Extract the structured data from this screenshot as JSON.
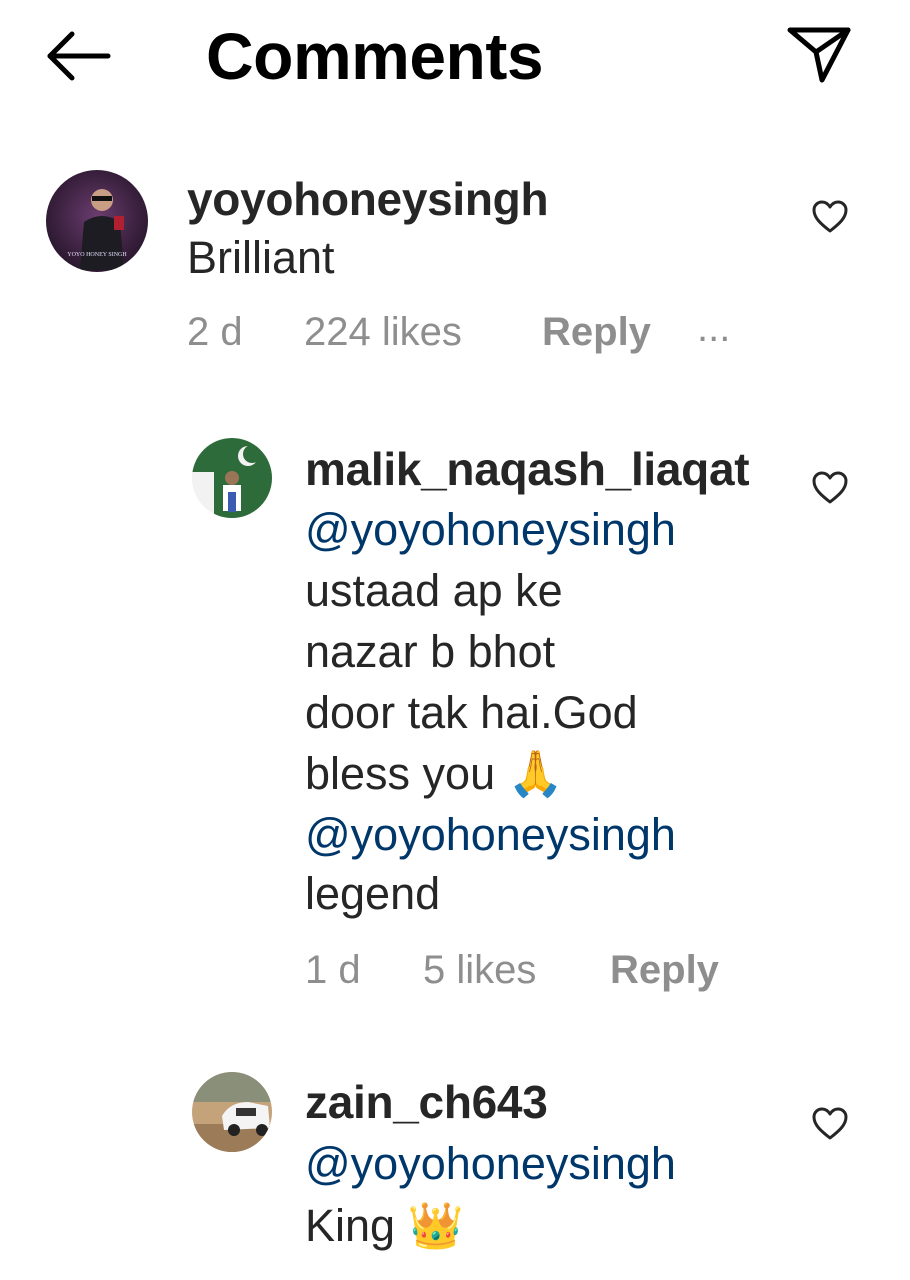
{
  "header": {
    "title": "Comments",
    "back_icon": "arrow-left-icon",
    "share_icon": "send-icon"
  },
  "comments": [
    {
      "username": "yoyohoneysingh",
      "text": "Brilliant",
      "time": "2 d",
      "likes": "224 likes",
      "reply": "Reply",
      "more": "...",
      "avatar_text": "YOYO HONEY SINGH"
    },
    {
      "username": "malik_naqash_liaqat",
      "lines": [
        "@yoyohoneysingh",
        "ustaad ap ke",
        "nazar b bhot",
        "door tak hai.God",
        "bless you 🙏",
        "@yoyohoneysingh",
        "legend"
      ],
      "time": "1 d",
      "likes": "5 likes",
      "reply": "Reply"
    },
    {
      "username": "zain_ch643",
      "lines": [
        "@yoyohoneysingh",
        "King 👑"
      ]
    }
  ],
  "colors": {
    "text": "#262626",
    "mention": "#00376b",
    "meta": "#8e8e8e",
    "background": "#ffffff"
  }
}
